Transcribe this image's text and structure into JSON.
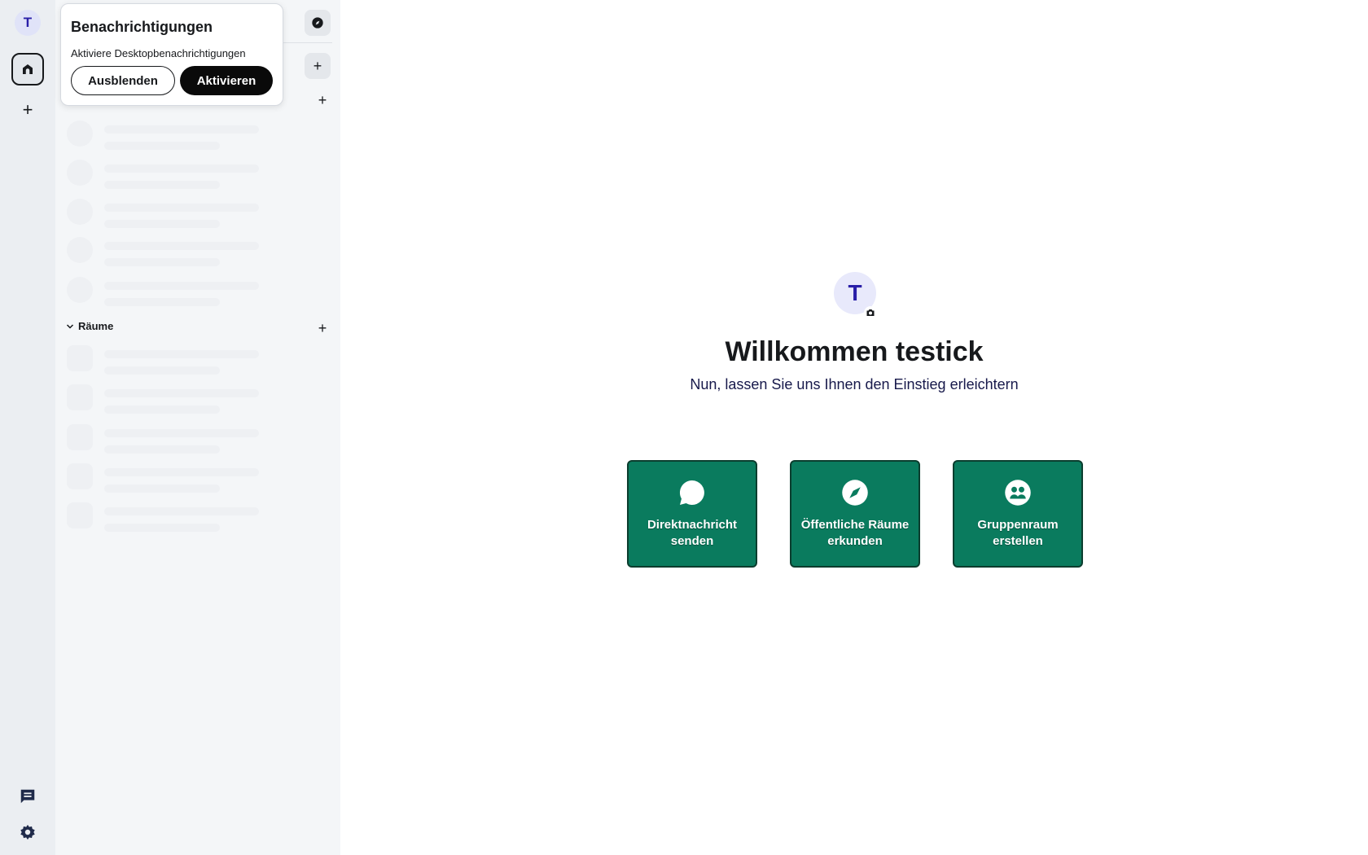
{
  "spacebar": {
    "user_initial": "T",
    "add_label": "+",
    "icons": [
      "home-icon",
      "chat-icon",
      "gear-icon"
    ]
  },
  "roomlist": {
    "add_label": "+",
    "rooms_section_label": "Räume",
    "skeleton_rows_people": 5,
    "skeleton_rows_rooms": 5
  },
  "notification": {
    "title": "Benachrichtigungen",
    "text": "Aktiviere Desktopbenachrichtigungen",
    "hide_label": "Ausblenden",
    "activate_label": "Aktivieren"
  },
  "welcome": {
    "avatar_initial": "T",
    "title": "Willkommen testick",
    "subtitle": "Nun, lassen Sie uns Ihnen den Einstieg erleichtern",
    "actions": [
      {
        "line1": "Direktnachricht",
        "line2": "senden",
        "icon": "chat-bubble-icon"
      },
      {
        "line1": "Öffentliche Räume",
        "line2": "erkunden",
        "icon": "compass-icon"
      },
      {
        "line1": "Gruppenraum",
        "line2": "erstellen",
        "icon": "group-icon"
      }
    ]
  },
  "colors": {
    "accent_green": "#0a7b5e",
    "avatar_text": "#2a1fa8",
    "panel_bg": "#f4f6f8",
    "spacebar_bg": "#ebeef2"
  }
}
